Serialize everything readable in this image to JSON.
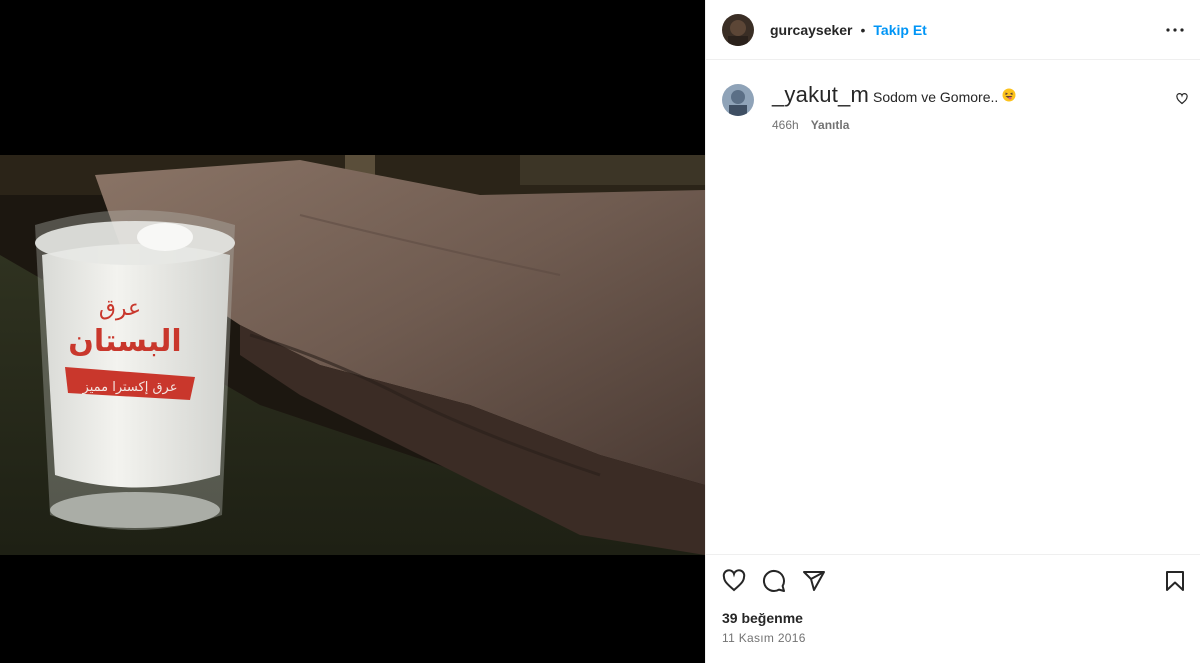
{
  "post": {
    "author": "gurcayseker",
    "separator": "•",
    "follow_label": "Takip Et",
    "more_icon": "more-horizontal-icon"
  },
  "media": {
    "glass_brand_line1": "عرق",
    "glass_brand_line2": "البستان",
    "glass_banner": "عرق إكسترا مميز"
  },
  "comments": [
    {
      "username": "_yakut_m",
      "text": "Sodom ve Gomore..",
      "emoji_icon": "laughing-tongue-emoji-icon",
      "time": "466h",
      "reply_label": "Yanıtla"
    }
  ],
  "actions": {
    "like_icon": "heart-icon",
    "comment_icon": "comment-icon",
    "share_icon": "send-icon",
    "save_icon": "bookmark-icon",
    "likes_text": "39 beğenme",
    "date_text": "11 Kasım 2016"
  },
  "colors": {
    "link_blue": "#0095f6",
    "text": "#262626",
    "muted": "#737373",
    "divider": "#efefef"
  }
}
